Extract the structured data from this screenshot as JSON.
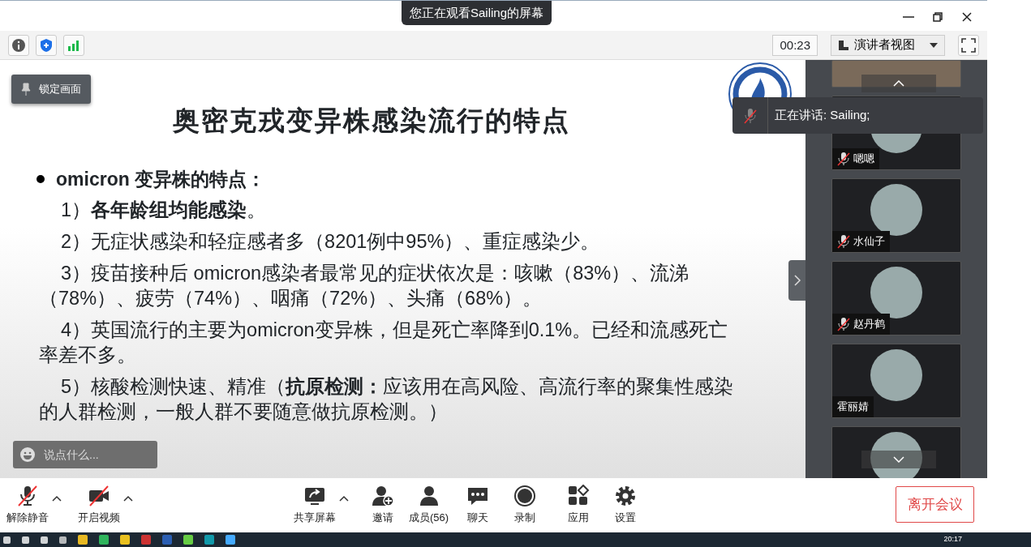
{
  "window": {
    "banner": "您正在观看Sailing的屏幕"
  },
  "toolbar": {
    "timer": "00:23",
    "view": "演讲者视图"
  },
  "lock_button": "锁定画面",
  "slide": {
    "title": "奥密克戎变异株感染流行的特点",
    "bullet": "omicron 变异株的特点：",
    "items": [
      "1）**各年龄组均能感染**。",
      "2）无症状感染和轻症感者多（8201例中95%）、重症感染少。",
      "3）疫苗接种后 omicron感染者最常见的症状依次是：咳嗽（83%）、流涕（78%）、疲劳（74%）、咽痛（72%）、头痛（68%）。",
      "4）英国流行的主要为omicron变异株，但是死亡率降到0.1%。已经和流感死亡率差不多。",
      "5）核酸检测快速、精准（**抗原检测：**应该用在高风险、高流行率的聚集性感染的人群检测，一般人群不要随意做抗原检测。）"
    ]
  },
  "comment": {
    "placeholder": "说点什么..."
  },
  "speaking": "正在讲话: Sailing;",
  "participants": [
    {
      "kind": "video",
      "muted": false
    },
    {
      "kind": "avatar",
      "name": "嗯嗯",
      "muted": true
    },
    {
      "kind": "avatar",
      "name": "水仙子",
      "muted": true
    },
    {
      "kind": "avatar",
      "name": "赵丹鹤",
      "muted": true
    },
    {
      "kind": "avatar",
      "name": "霍丽婧",
      "muted": false
    },
    {
      "kind": "avatar",
      "muted": false
    }
  ],
  "controls": [
    {
      "label": "解除静音",
      "off": true,
      "caret": true
    },
    {
      "label": "开启视频",
      "off": true,
      "caret": true
    },
    {
      "label": "共享屏幕",
      "off": false,
      "caret": true
    },
    {
      "label": "邀请",
      "off": false,
      "caret": false
    },
    {
      "label": "成员(56)",
      "off": false,
      "caret": false
    },
    {
      "label": "聊天",
      "off": false,
      "caret": false
    },
    {
      "label": "录制",
      "off": false,
      "caret": false
    },
    {
      "label": "应用",
      "off": false,
      "caret": false
    },
    {
      "label": "设置",
      "off": false,
      "caret": false
    }
  ],
  "leave_button": "离开会议",
  "taskbar": {
    "time": "20:17"
  }
}
